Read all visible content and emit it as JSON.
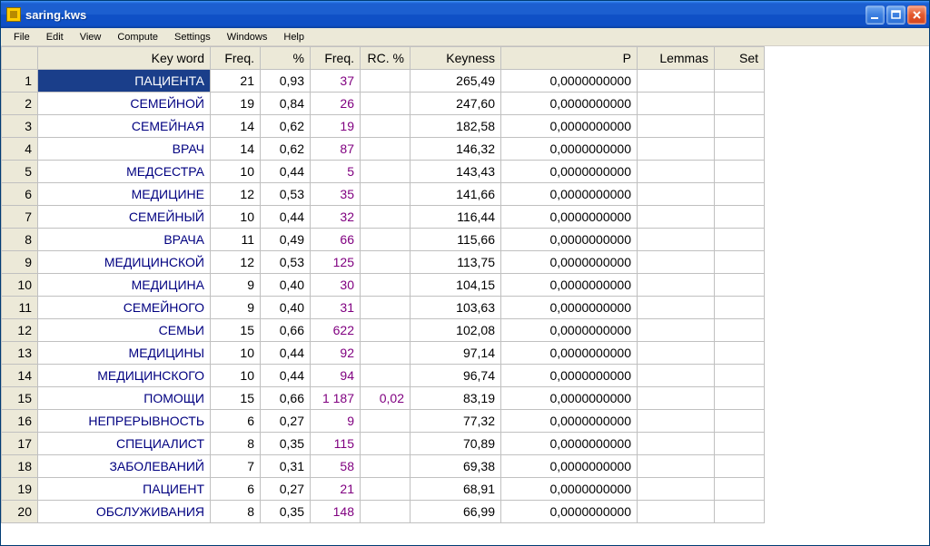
{
  "window": {
    "title": "saring.kws"
  },
  "menu": [
    "File",
    "Edit",
    "View",
    "Compute",
    "Settings",
    "Windows",
    "Help"
  ],
  "columns": [
    {
      "key": "keyword",
      "label": "Key word",
      "cls": "col-keyword"
    },
    {
      "key": "freq",
      "label": "Freq.",
      "cls": "col-freq"
    },
    {
      "key": "pct",
      "label": "%",
      "cls": "col-pct"
    },
    {
      "key": "freq2",
      "label": "Freq.",
      "cls": "col-freq2"
    },
    {
      "key": "rcpct",
      "label": "RC. %",
      "cls": "col-rcpct"
    },
    {
      "key": "keyness",
      "label": "Keyness",
      "cls": "col-keyness"
    },
    {
      "key": "p",
      "label": "P",
      "cls": "col-p"
    },
    {
      "key": "lemmas",
      "label": "Lemmas",
      "cls": "col-lemmas"
    },
    {
      "key": "set",
      "label": "Set",
      "cls": "col-set"
    }
  ],
  "rows": [
    {
      "n": "1",
      "keyword": "ПАЦИЕНТА",
      "freq": "21",
      "pct": "0,93",
      "freq2": "37",
      "rcpct": "",
      "keyness": "265,49",
      "p": "0,0000000000",
      "selected": true
    },
    {
      "n": "2",
      "keyword": "СЕМЕЙНОЙ",
      "freq": "19",
      "pct": "0,84",
      "freq2": "26",
      "rcpct": "",
      "keyness": "247,60",
      "p": "0,0000000000"
    },
    {
      "n": "3",
      "keyword": "СЕМЕЙНАЯ",
      "freq": "14",
      "pct": "0,62",
      "freq2": "19",
      "rcpct": "",
      "keyness": "182,58",
      "p": "0,0000000000"
    },
    {
      "n": "4",
      "keyword": "ВРАЧ",
      "freq": "14",
      "pct": "0,62",
      "freq2": "87",
      "rcpct": "",
      "keyness": "146,32",
      "p": "0,0000000000"
    },
    {
      "n": "5",
      "keyword": "МЕДСЕСТРА",
      "freq": "10",
      "pct": "0,44",
      "freq2": "5",
      "rcpct": "",
      "keyness": "143,43",
      "p": "0,0000000000"
    },
    {
      "n": "6",
      "keyword": "МЕДИЦИНЕ",
      "freq": "12",
      "pct": "0,53",
      "freq2": "35",
      "rcpct": "",
      "keyness": "141,66",
      "p": "0,0000000000"
    },
    {
      "n": "7",
      "keyword": "СЕМЕЙНЫЙ",
      "freq": "10",
      "pct": "0,44",
      "freq2": "32",
      "rcpct": "",
      "keyness": "116,44",
      "p": "0,0000000000"
    },
    {
      "n": "8",
      "keyword": "ВРАЧА",
      "freq": "11",
      "pct": "0,49",
      "freq2": "66",
      "rcpct": "",
      "keyness": "115,66",
      "p": "0,0000000000"
    },
    {
      "n": "9",
      "keyword": "МЕДИЦИНСКОЙ",
      "freq": "12",
      "pct": "0,53",
      "freq2": "125",
      "rcpct": "",
      "keyness": "113,75",
      "p": "0,0000000000"
    },
    {
      "n": "10",
      "keyword": "МЕДИЦИНА",
      "freq": "9",
      "pct": "0,40",
      "freq2": "30",
      "rcpct": "",
      "keyness": "104,15",
      "p": "0,0000000000"
    },
    {
      "n": "11",
      "keyword": "СЕМЕЙНОГО",
      "freq": "9",
      "pct": "0,40",
      "freq2": "31",
      "rcpct": "",
      "keyness": "103,63",
      "p": "0,0000000000"
    },
    {
      "n": "12",
      "keyword": "СЕМЬИ",
      "freq": "15",
      "pct": "0,66",
      "freq2": "622",
      "rcpct": "",
      "keyness": "102,08",
      "p": "0,0000000000"
    },
    {
      "n": "13",
      "keyword": "МЕДИЦИНЫ",
      "freq": "10",
      "pct": "0,44",
      "freq2": "92",
      "rcpct": "",
      "keyness": "97,14",
      "p": "0,0000000000"
    },
    {
      "n": "14",
      "keyword": "МЕДИЦИНСКОГО",
      "freq": "10",
      "pct": "0,44",
      "freq2": "94",
      "rcpct": "",
      "keyness": "96,74",
      "p": "0,0000000000"
    },
    {
      "n": "15",
      "keyword": "ПОМОЩИ",
      "freq": "15",
      "pct": "0,66",
      "freq2": "1 187",
      "rcpct": "0,02",
      "keyness": "83,19",
      "p": "0,0000000000"
    },
    {
      "n": "16",
      "keyword": "НЕПРЕРЫВНОСТЬ",
      "freq": "6",
      "pct": "0,27",
      "freq2": "9",
      "rcpct": "",
      "keyness": "77,32",
      "p": "0,0000000000"
    },
    {
      "n": "17",
      "keyword": "СПЕЦИАЛИСТ",
      "freq": "8",
      "pct": "0,35",
      "freq2": "115",
      "rcpct": "",
      "keyness": "70,89",
      "p": "0,0000000000"
    },
    {
      "n": "18",
      "keyword": "ЗАБОЛЕВАНИЙ",
      "freq": "7",
      "pct": "0,31",
      "freq2": "58",
      "rcpct": "",
      "keyness": "69,38",
      "p": "0,0000000000"
    },
    {
      "n": "19",
      "keyword": "ПАЦИЕНТ",
      "freq": "6",
      "pct": "0,27",
      "freq2": "21",
      "rcpct": "",
      "keyness": "68,91",
      "p": "0,0000000000"
    },
    {
      "n": "20",
      "keyword": "ОБСЛУЖИВАНИЯ",
      "freq": "8",
      "pct": "0,35",
      "freq2": "148",
      "rcpct": "",
      "keyness": "66,99",
      "p": "0,0000000000"
    }
  ]
}
